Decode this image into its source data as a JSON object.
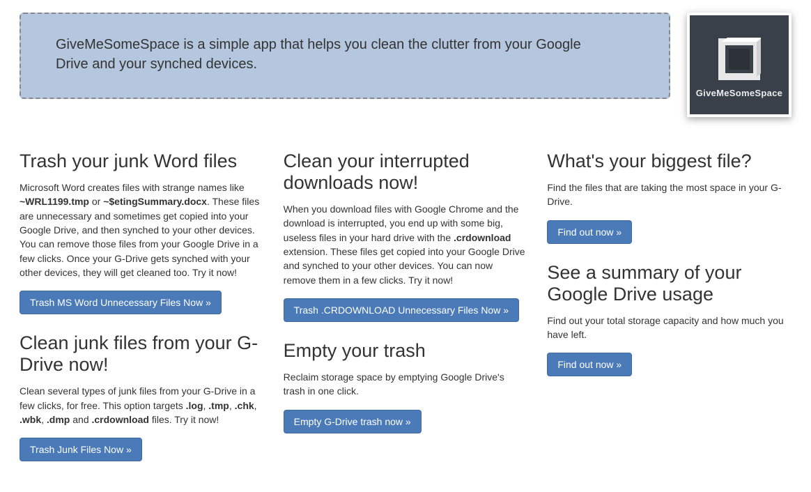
{
  "banner": {
    "text": "GiveMeSomeSpace is a simple app that helps you clean the clutter from your Google Drive and your synched devices."
  },
  "logo": {
    "label": "GiveMeSomeSpace"
  },
  "col1": {
    "s1": {
      "title": "Trash your junk Word files",
      "desc_before": "Microsoft Word creates files with strange names like ",
      "bold1": "~WRL1199.tmp",
      "mid1": " or ",
      "bold2": "~$etingSummary.docx",
      "desc_after": ". These files are unnecessary and sometimes get copied into your Google Drive, and then synched to your other devices. You can remove those files from your Google Drive in a few clicks. Once your G-Drive gets synched with your other devices, they will get cleaned too. Try it now!",
      "button": "Trash MS Word Unnecessary Files Now »"
    },
    "s2": {
      "title": "Clean junk files from your G-Drive now!",
      "desc_before": "Clean several types of junk files from your G-Drive in a few clicks, for free. This option targets ",
      "b_log": ".log",
      "c1": ", ",
      "b_tmp": ".tmp",
      "c2": ", ",
      "b_chk": ".chk",
      "c3": ", ",
      "b_wbk": ".wbk",
      "c4": ", ",
      "b_dmp": ".dmp",
      "c5": " and ",
      "b_crd": ".crdownload",
      "desc_after": " files. Try it now!",
      "button": "Trash Junk Files Now »"
    }
  },
  "col2": {
    "s1": {
      "title": "Clean your interrupted downloads now!",
      "desc_before": "When you download files with Google Chrome and the download is interrupted, you end up with some big, useless files in your hard drive with the ",
      "bold1": ".crdownload",
      "desc_after": " extension. These files get copied into your Google Drive and synched to your other devices. You can now remove them in a few clicks. Try it now!",
      "button": "Trash .CRDOWNLOAD Unnecessary Files Now »"
    },
    "s2": {
      "title": "Empty your trash",
      "desc": "Reclaim storage space by emptying Google Drive's trash in one click.",
      "button": "Empty G-Drive trash now »"
    }
  },
  "col3": {
    "s1": {
      "title": "What's your biggest file?",
      "desc": "Find the files that are taking the most space in your G-Drive.",
      "button": "Find out now »"
    },
    "s2": {
      "title": "See a summary of your Google Drive usage",
      "desc": "Find out your total storage capacity and how much you have left.",
      "button": "Find out now »"
    }
  }
}
